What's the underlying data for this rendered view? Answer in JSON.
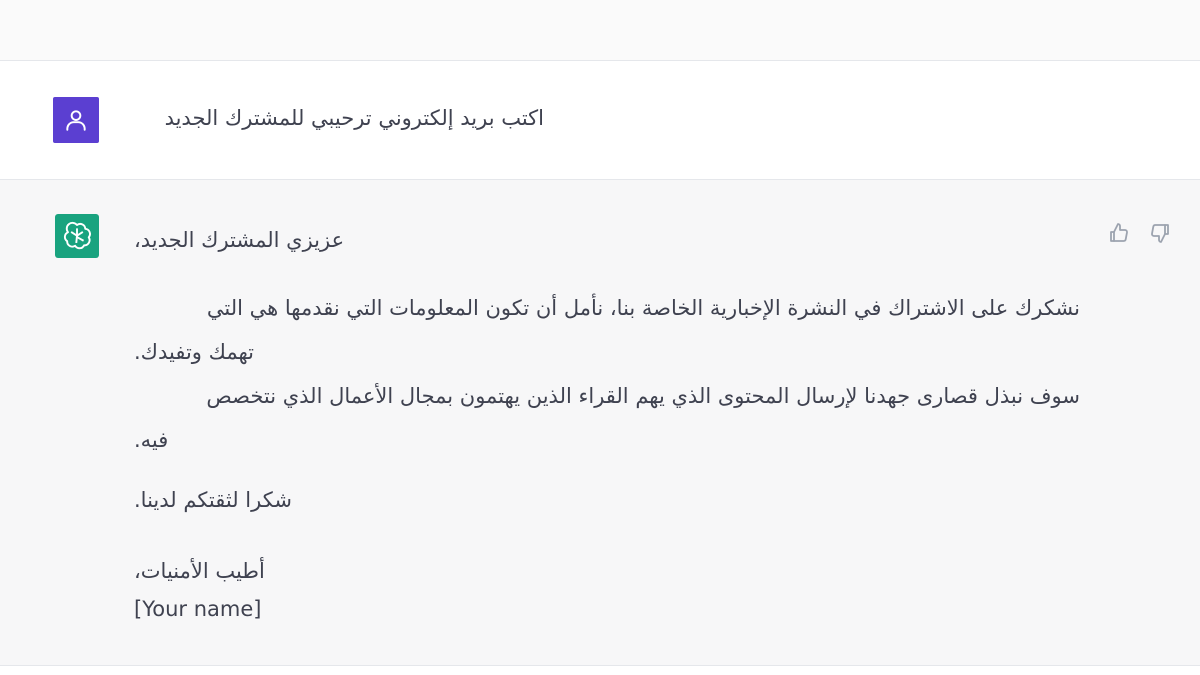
{
  "user_message": {
    "avatar_icon": "person-icon",
    "avatar_color": "#5b3fd1",
    "text": "اكتب بريد إلكتروني ترحيبي للمشترك الجديد"
  },
  "assistant_message": {
    "avatar_icon": "openai-logo-icon",
    "avatar_color": "#19a37f",
    "greeting": "عزيزي المشترك الجديد،",
    "paragraph1_line1": "نشكرك على الاشتراك في النشرة الإخبارية الخاصة بنا، نأمل أن تكون المعلومات التي نقدمها هي التي",
    "paragraph1_line2": "تهمك وتفيدك.",
    "paragraph2_line1": "سوف نبذل قصارى جهدنا لإرسال المحتوى الذي يهم القراء الذين يهتمون بمجال الأعمال الذي نتخصص",
    "paragraph2_line2": "فيه.",
    "thanks": "شكرا لثقتكم لدينا.",
    "closing": "أطيب الأمنيات،",
    "signature": "[Your name]"
  },
  "feedback": {
    "thumbs_up_icon": "thumbs-up-icon",
    "thumbs_down_icon": "thumbs-down-icon"
  }
}
